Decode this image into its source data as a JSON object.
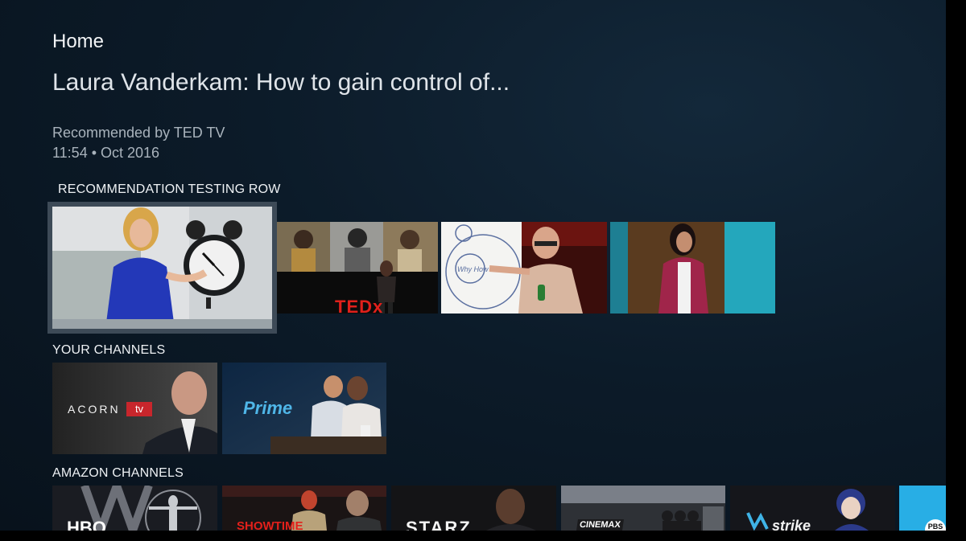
{
  "header": {
    "page": "Home",
    "title": "Laura Vanderkam: How to gain control of...",
    "recommended_by": "Recommended by TED TV",
    "duration_date": "11:54 • Oct 2016"
  },
  "rows": {
    "recommendation": {
      "label": "RECOMMENDATION TESTING ROW",
      "tiles": [
        {
          "name": "talk-tile-laura-vanderkam",
          "focused": true
        },
        {
          "name": "talk-tile-tedx",
          "overlay_text": "TEDx"
        },
        {
          "name": "talk-tile-whiteboard",
          "overlay_text": "Why How"
        },
        {
          "name": "talk-tile-speaker-red"
        }
      ]
    },
    "your_channels": {
      "label": "YOUR CHANNELS",
      "tiles": [
        {
          "name": "channel-acorn-tv",
          "brand": "ACORN",
          "brand_badge": "tv"
        },
        {
          "name": "channel-prime",
          "brand": "Prime"
        }
      ]
    },
    "amazon_channels": {
      "label": "AMAZON CHANNELS",
      "tiles": [
        {
          "name": "channel-hbo",
          "brand": "HBO"
        },
        {
          "name": "channel-showtime",
          "brand": "SHOWTIME"
        },
        {
          "name": "channel-starz",
          "brand": "STARZ"
        },
        {
          "name": "channel-cinemax",
          "brand": "CINEMAX"
        },
        {
          "name": "channel-strike",
          "brand": "strike"
        },
        {
          "name": "channel-pbs",
          "brand": "PBS"
        }
      ]
    }
  },
  "colors": {
    "background": "#0c1b29",
    "focus_ring": "#3d4a57",
    "acorn_red": "#c8262c",
    "prime_blue": "#4fb6e8"
  }
}
